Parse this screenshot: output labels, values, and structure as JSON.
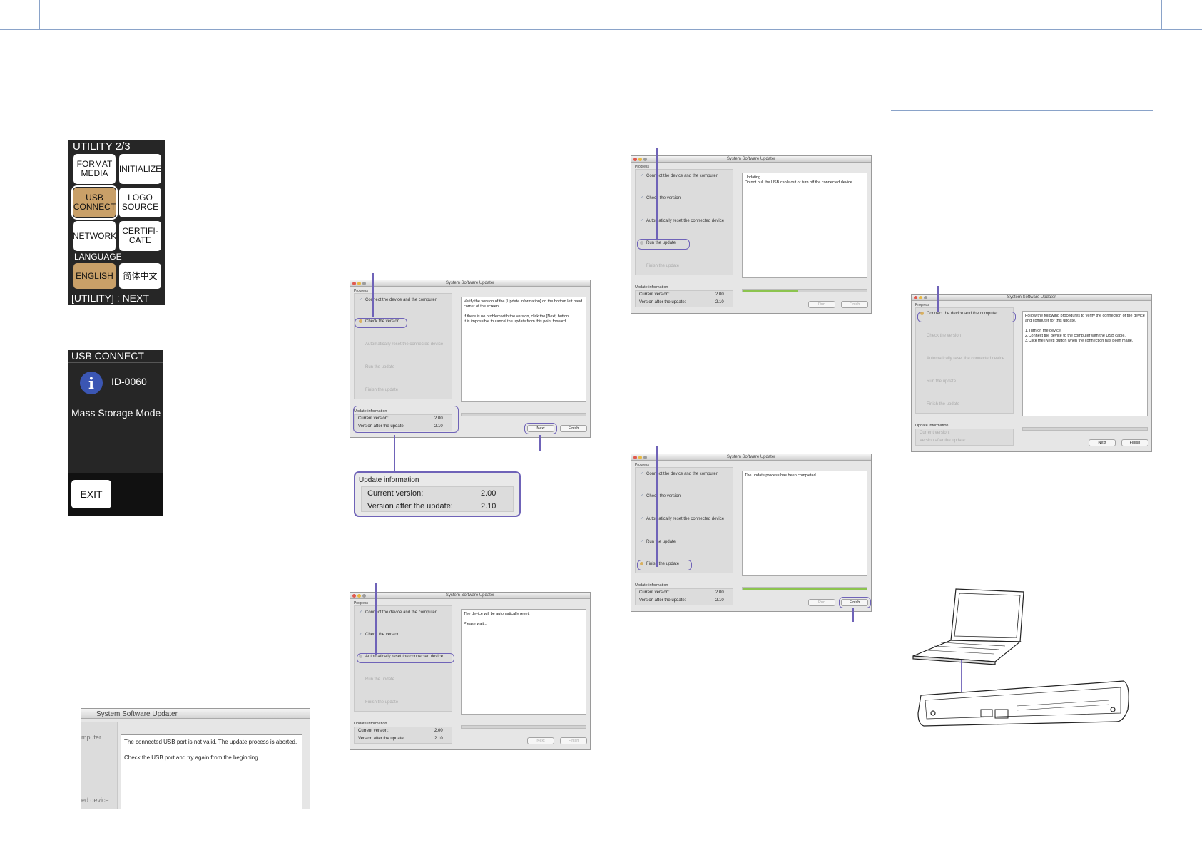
{
  "updater": {
    "title": "System Software Updater",
    "progress_label": "Progress",
    "steps": [
      "Connect the device and the computer",
      "Check the version",
      "Automatically reset the connected device",
      "Run the update",
      "Finish the update"
    ],
    "info_title": "Update information",
    "current_label": "Current version:",
    "current_value": "2.00",
    "after_label": "Version after the update:",
    "after_value": "2.10",
    "next": "Next",
    "finish": "Finish",
    "run": "Run",
    "traffic_colors": [
      "#e05a4f",
      "#e8b842",
      "#9c9c9c"
    ],
    "accent": "#6f63b8"
  },
  "utility_panel": {
    "title": "UTILITY 2/3",
    "buttons": [
      "FORMAT\nMEDIA",
      "INITIALIZE",
      "USB\nCONNECT",
      "LOGO\nSOURCE",
      "NETWORK",
      "CERTIFI-\nCATE"
    ],
    "language_label": "LANGUAGE",
    "lang_buttons": [
      "ENGLISH",
      "简体中文"
    ],
    "footer": "[UTILITY] : NEXT"
  },
  "usb_panel": {
    "title": "USB CONNECT",
    "id": "ID-0060",
    "mode": "Mass Storage Mode",
    "exit": "EXIT"
  },
  "messages": {
    "check_version": "Verify the version of the [Update information] on the bottom left hand corner of the screen.\n\nIf there is no problem with the version, click the [Next] button.\nIt is impossible to cancel the update from this point forward.",
    "reset": "The device will be automatically reset.\n\nPlease wait...",
    "updating": "Updating.\nDo not pull the USB cable out or turn off the connected device.",
    "completed": "The update process has been completed.",
    "connect": "Follow the following procedures to verify the connection of the device and computer for this update.\n\n1.Turn on the device.\n2.Connect the device to the computer with the USB cable.\n3.Click the [Next] button when the connection has been made."
  },
  "error_crop": {
    "title": "System Software Updater",
    "side_top": "mputer",
    "side_bottom": "ed device",
    "message": "The connected USB port is not valid. The update process is aborted.\n\nCheck the USB port and try again from the beginning."
  },
  "zoom": {
    "title": "Update information",
    "current_label": "Current version:",
    "current_value": "2.00",
    "after_label": "Version after the update:",
    "after_value": "2.10"
  },
  "progress": {
    "updating_fill": 0.45,
    "completed_fill": 1.0
  }
}
